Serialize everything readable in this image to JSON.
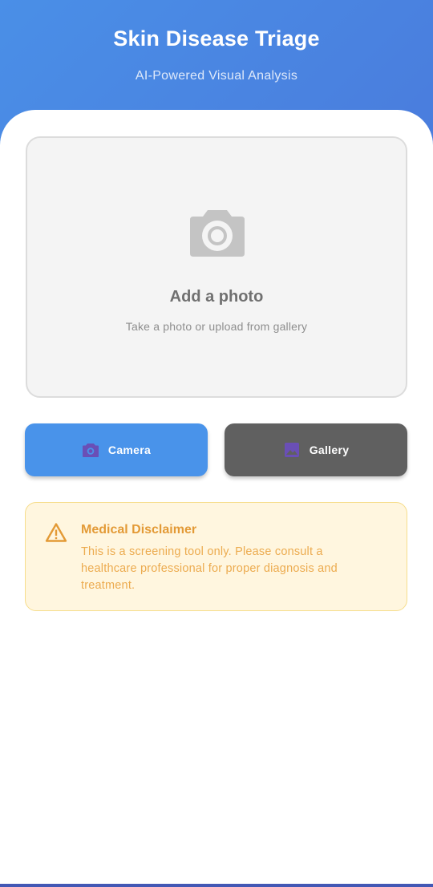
{
  "app": {
    "title": "Skin Disease Triage",
    "subtitle": "AI-Powered Visual Analysis"
  },
  "upload": {
    "icon": "camera-icon",
    "title": "Add a photo",
    "hint": "Take a photo or upload from gallery"
  },
  "actions": {
    "camera_label": "Camera",
    "camera_icon": "camera-icon",
    "gallery_label": "Gallery",
    "gallery_icon": "gallery-icon"
  },
  "disclaimer": {
    "icon": "warning-icon",
    "title": "Medical Disclaimer",
    "text": "This is a screening tool only. Please consult a healthcare professional for proper diagnosis and treatment."
  },
  "colors": {
    "header_start": "#4a8fe7",
    "header_end": "#4a7bdc",
    "camera_button": "#4993ea",
    "gallery_button": "#606060",
    "disclaimer_bg": "#fff6df",
    "disclaimer_text": "#ecab4f",
    "icon_purple": "#6a4fb6"
  }
}
